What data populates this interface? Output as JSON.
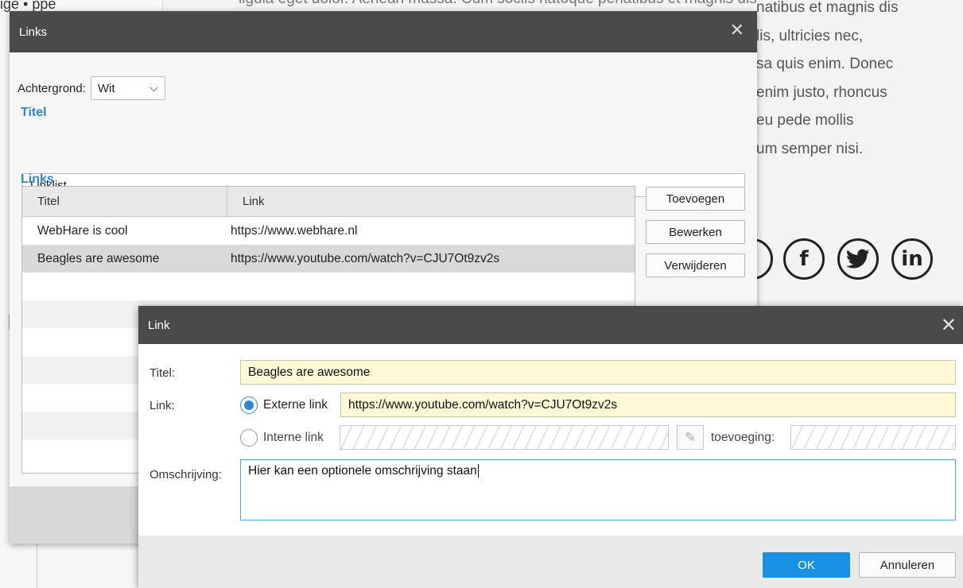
{
  "background": {
    "top_label": "ige • ppe",
    "top_text": "ligula eget dolor. Aenean massa. Cum sociis natoque penatibus et magnis dis",
    "side_text_lines": [
      "natibus et magnis dis",
      "lis, ultricies nec,",
      "sa quis enim. Donec",
      "enim justo, rhoncus",
      "eu pede mollis",
      "um semper nisi."
    ],
    "social": {
      "partial": ")",
      "facebook": "f",
      "twitter": "🐦",
      "linkedin": "in"
    }
  },
  "links_dialog": {
    "title": "Links",
    "close": "✕",
    "background_label": "Achtergrond:",
    "background_value": "Wit",
    "title_section": "Titel",
    "title_value": "Linklist",
    "links_section": "Links",
    "columns": [
      "Titel",
      "Link"
    ],
    "rows": [
      {
        "title": "WebHare is cool",
        "link": "https://www.webhare.nl"
      },
      {
        "title": "Beagles are awesome",
        "link": "https://www.youtube.com/watch?v=CJU7Ot9zv2s"
      }
    ],
    "buttons": {
      "add": "Toevoegen",
      "edit": "Bewerken",
      "delete": "Verwijderen"
    }
  },
  "link_dialog": {
    "title": "Link",
    "close": "✕",
    "title_label": "Titel:",
    "title_value": "Beagles are awesome",
    "link_label": "Link:",
    "external_label": "Externe link",
    "external_value": "https://www.youtube.com/watch?v=CJU7Ot9zv2s",
    "internal_label": "Interne link",
    "addition_label": "toevoeging:",
    "description_label": "Omschrijving:",
    "description_value": "Hier kan een optionele omschrijving staan",
    "ok": "OK",
    "cancel": "Annuleren"
  }
}
